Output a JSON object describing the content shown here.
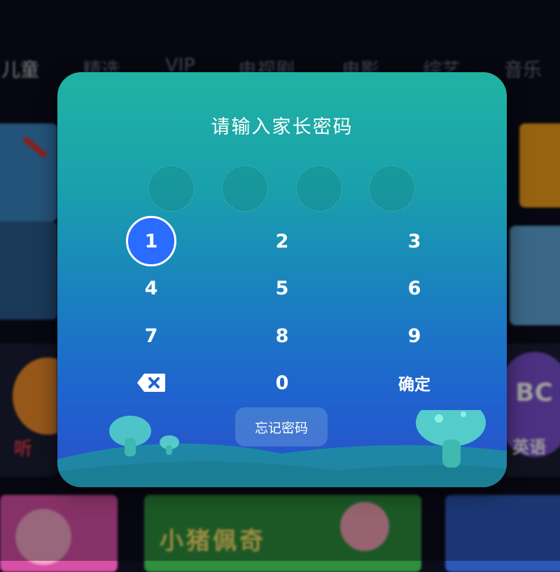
{
  "nav": {
    "tabs": [
      {
        "label": "儿童",
        "active": true
      },
      {
        "label": "精选",
        "active": false
      },
      {
        "label": "VIP",
        "active": false
      },
      {
        "label": "电视剧",
        "active": false
      },
      {
        "label": "电影",
        "active": false
      },
      {
        "label": "综艺",
        "active": false
      },
      {
        "label": "音乐",
        "active": false
      }
    ]
  },
  "background_tiles": {
    "tile_1_label": "",
    "tile_2_label": "",
    "tile_3_label": "小猪佩奇",
    "tile_4_label": "",
    "tile_5_label": "英语",
    "tile_6_label": "BC",
    "tile_7_label": "听"
  },
  "dialog": {
    "title": "请输入家长密码",
    "pin_length": 4,
    "keypad": {
      "digits": [
        "1",
        "2",
        "3",
        "4",
        "5",
        "6",
        "7",
        "8",
        "9",
        "0"
      ],
      "confirm_label": "确定",
      "focused_key": "1"
    },
    "forgot_label": "忘记密码"
  },
  "colors": {
    "dialog_top": "#1fb3a3",
    "dialog_bottom": "#2a4fc9",
    "focus_ring": "#2a6cff"
  }
}
